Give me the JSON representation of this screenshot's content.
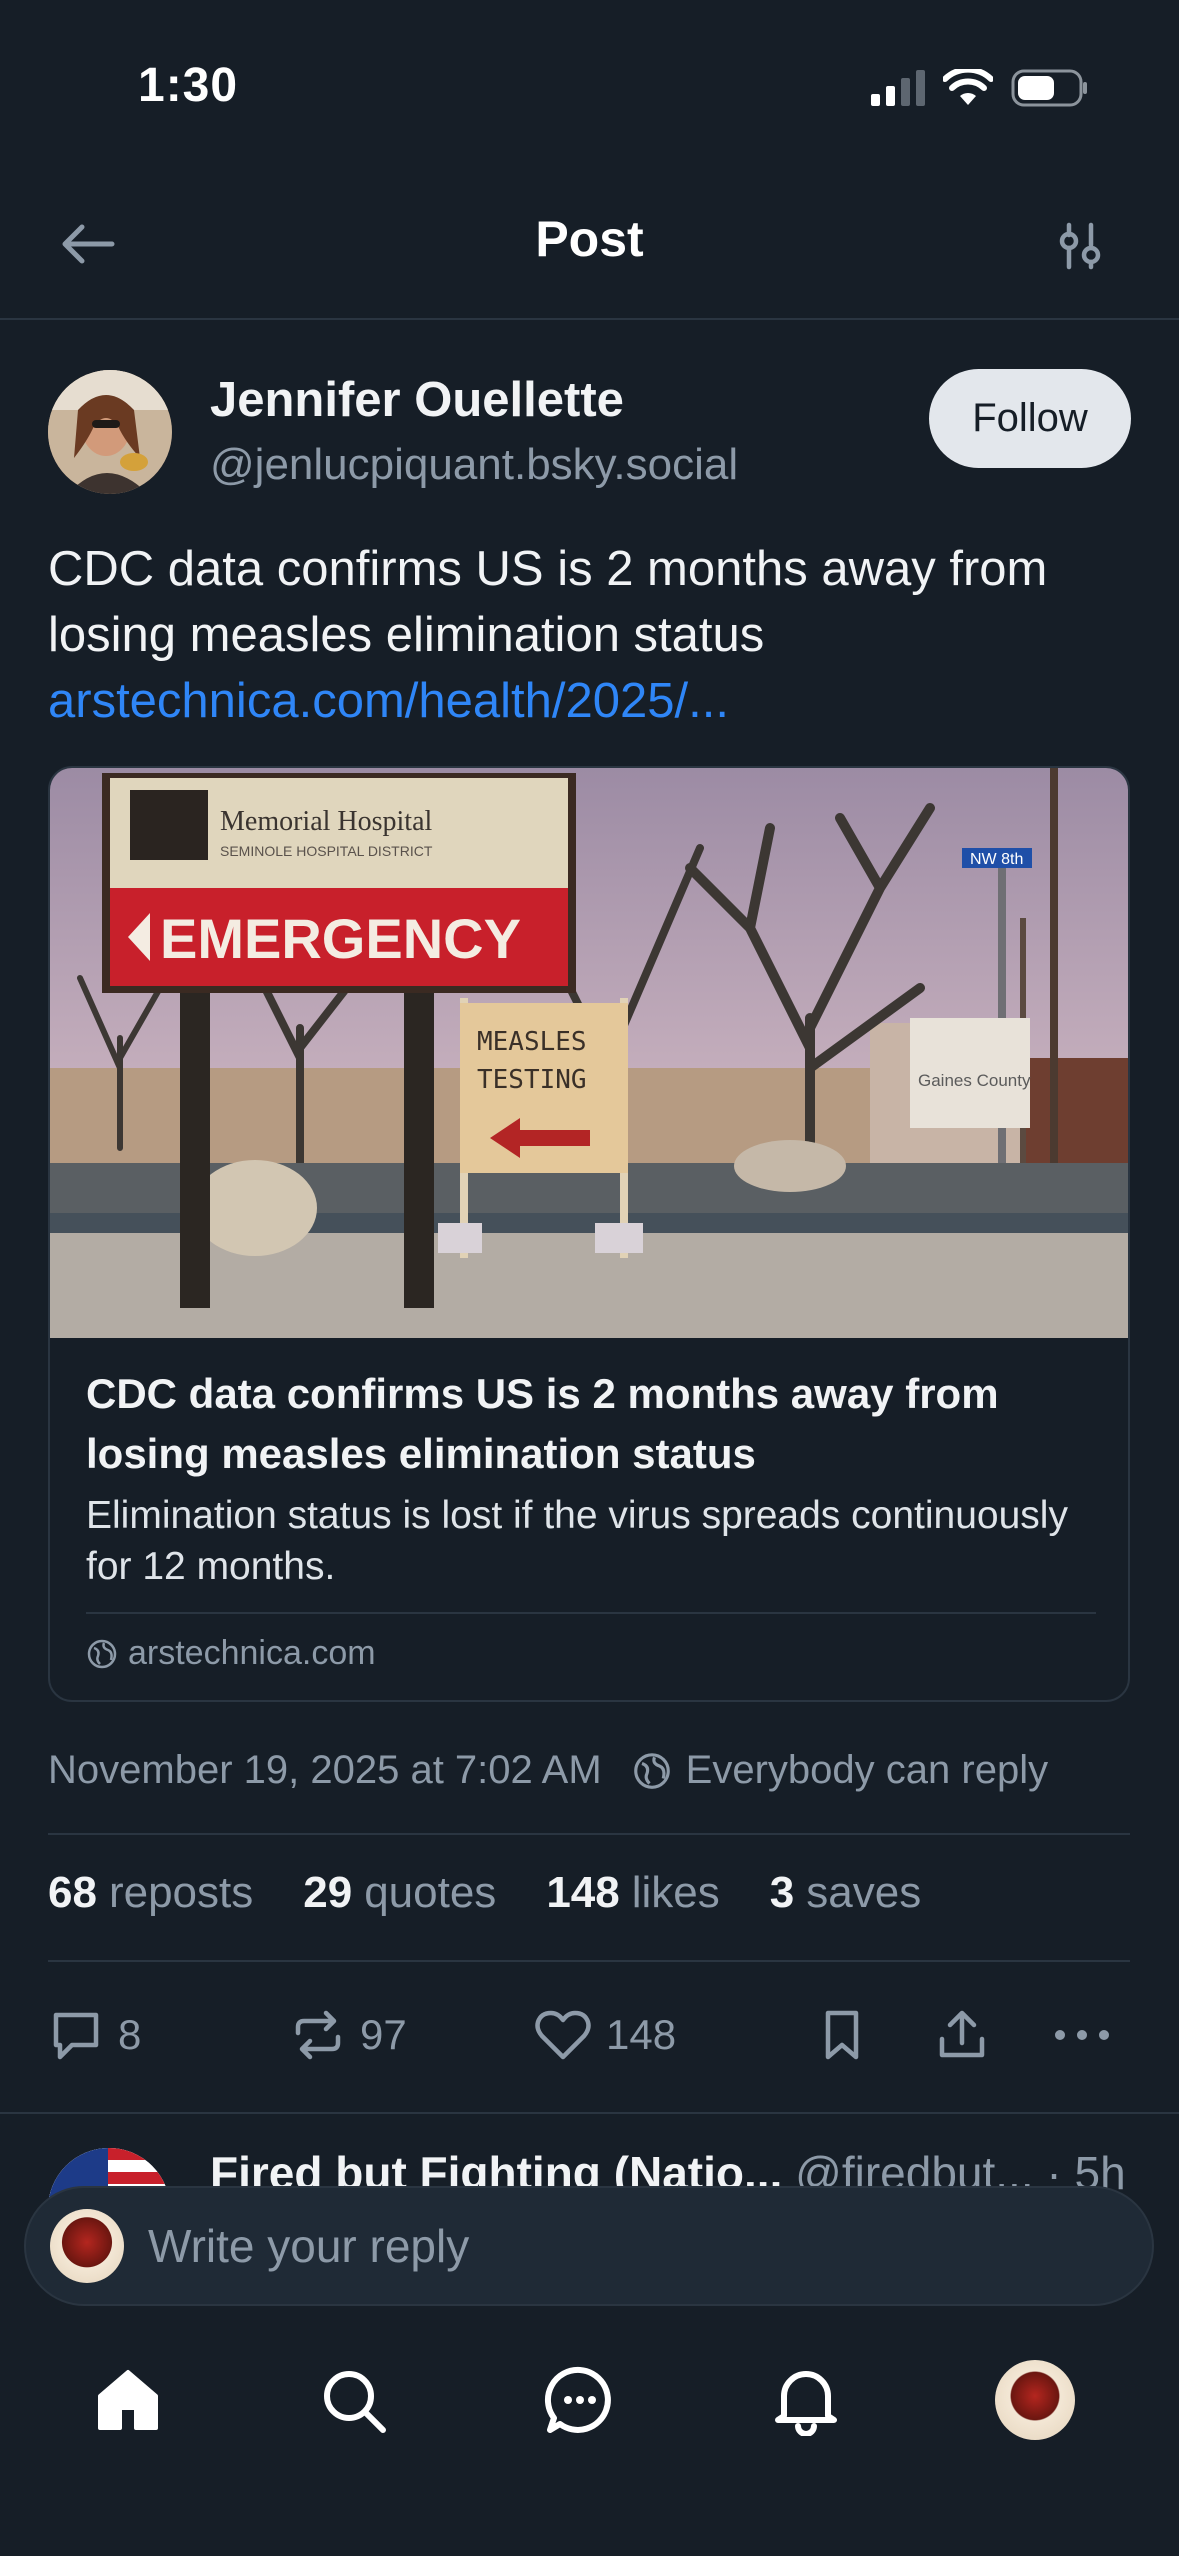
{
  "status_bar": {
    "time": "1:30"
  },
  "header": {
    "title": "Post"
  },
  "author": {
    "name": "Jennifer Ouellette",
    "handle": "@jenlucpiquant.bsky.social",
    "follow_label": "Follow"
  },
  "post": {
    "text": "CDC data confirms US is 2 months away from losing measles elimination status",
    "link_text": "arstechnica.com/health/2025/..."
  },
  "link_card": {
    "image_sign_hospital_line1": "Memorial Hospital",
    "image_sign_hospital_line2": "SEMINOLE HOSPITAL DISTRICT",
    "image_sign_emergency": "EMERGENCY",
    "image_sign_measles_line1": "MEASLES",
    "image_sign_measles_line2": "TESTING",
    "image_sign_street": "NW 8th",
    "image_sign_county": "Gaines County",
    "title": "CDC data confirms US is 2 months away from losing measles elimination status",
    "description": "Elimination status is lost if the virus spreads continuously for 12 months.",
    "domain": "arstechnica.com"
  },
  "meta": {
    "timestamp": "November 19, 2025 at 7:02 AM",
    "reply_setting": "Everybody can reply"
  },
  "stats": [
    {
      "count": "68",
      "label": "reposts"
    },
    {
      "count": "29",
      "label": "quotes"
    },
    {
      "count": "148",
      "label": "likes"
    },
    {
      "count": "3",
      "label": "saves"
    }
  ],
  "actions": {
    "replies": "8",
    "reposts": "97",
    "likes": "148"
  },
  "next_reply": {
    "name": "Fired but Fighting (Natio...",
    "handle": "@firedbut...",
    "time": "· 5h"
  },
  "composer": {
    "placeholder": "Write your reply"
  },
  "icons": {
    "back": "arrow-left-icon",
    "filter": "sliders-icon",
    "globe": "globe-icon",
    "reply": "speech-bubble-icon",
    "repost": "repost-icon",
    "like": "heart-icon",
    "bookmark": "bookmark-icon",
    "share": "share-icon",
    "more": "ellipsis-icon",
    "home": "home-icon",
    "search": "search-icon",
    "chat": "chat-icon",
    "notifications": "bell-icon"
  },
  "colors": {
    "background": "#161e27",
    "accent_link": "#2f86f7",
    "muted_text": "#8d9aa8",
    "divider": "#2a3541"
  }
}
